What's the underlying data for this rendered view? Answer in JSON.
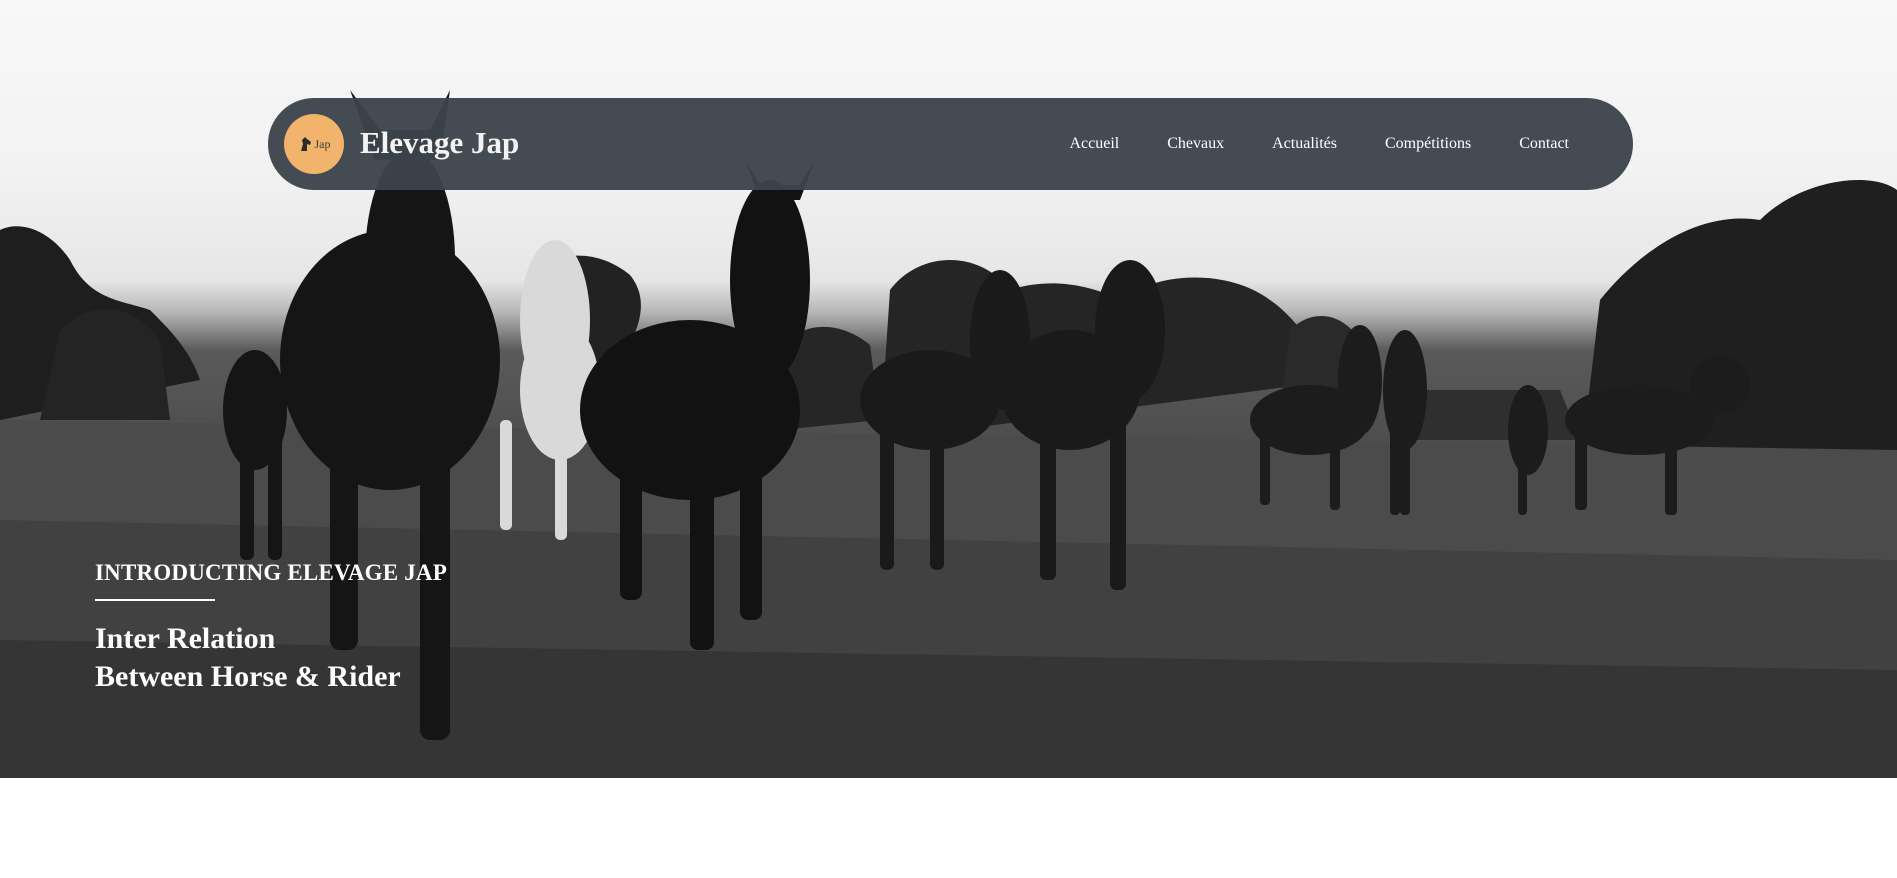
{
  "brand": {
    "logo_text": "Jap",
    "logo_icon": "horse-head-icon",
    "name": "Elevage Jap"
  },
  "nav": {
    "items": [
      {
        "label": "Accueil"
      },
      {
        "label": "Chevaux"
      },
      {
        "label": "Actualités"
      },
      {
        "label": "Compétitions"
      },
      {
        "label": "Contact"
      }
    ]
  },
  "hero": {
    "eyebrow": "INTRODUCTING ELEVAGE JAP",
    "headline_line1": "Inter Relation",
    "headline_line2": "Between Horse & Rider"
  },
  "colors": {
    "navbar_bg": "#3c444c",
    "logo_bg": "#f2b46d",
    "text": "#ffffff"
  }
}
